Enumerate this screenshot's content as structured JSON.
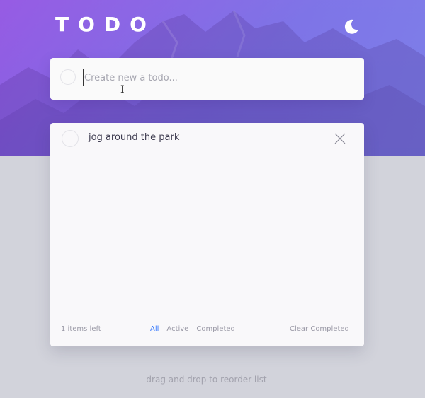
{
  "header": {
    "title": "TODO",
    "theme_icon": "moon-icon"
  },
  "new_todo": {
    "placeholder": "Create new a todo...",
    "value": ""
  },
  "todos": [
    {
      "text": "jog around the park",
      "completed": false
    }
  ],
  "footer": {
    "items_left": "1 items left",
    "filters": [
      "All",
      "Active",
      "Completed"
    ],
    "active_filter": "All",
    "clear_label": "Clear Completed"
  },
  "hint": "drag and drop to reorder list",
  "colors": {
    "accent": "#3a7bfd",
    "hero_start": "#9650e6",
    "hero_end": "#7882f0",
    "background": "#d2d3db"
  }
}
